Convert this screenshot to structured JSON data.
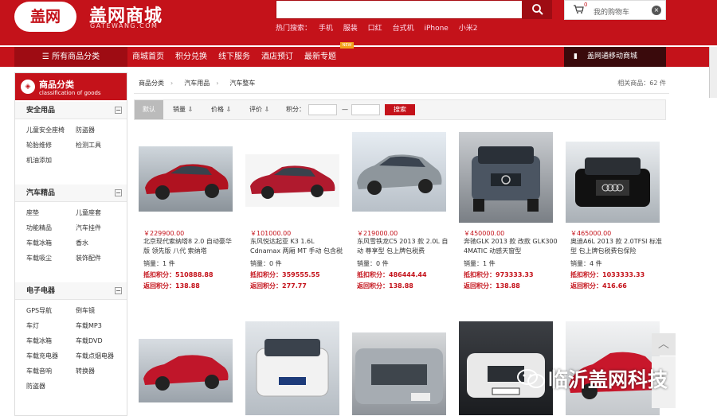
{
  "header": {
    "logo_badge": "盖网",
    "logo_name": "盖网商城",
    "logo_domain": "GATEWANG.COM",
    "hot_label": "热门搜索：",
    "hot_words": [
      "手机",
      "服装",
      "口红",
      "台式机",
      "iPhone",
      "小米2"
    ],
    "cart_text": "我的购物车",
    "cart_count": "0",
    "colors": {
      "brand": "#c4121a",
      "dark": "#9e0c13"
    }
  },
  "nav": {
    "all_label": "所有商品分类",
    "items": [
      "商城首页",
      "积分兑换",
      "线下服务",
      "酒店预订",
      "最新专题"
    ],
    "new_badge": "NEW",
    "phone_label": "盖网通移动商城"
  },
  "sidebar": {
    "title": "商品分类",
    "subtitle": "classification of goods",
    "sections": [
      {
        "title": "安全用品",
        "items": [
          "儿童安全座椅",
          "防盗器",
          "轮胎维修",
          "检测工具",
          "机油添加"
        ]
      },
      {
        "title": "汽车精品",
        "items": [
          "座垫",
          "儿童座套",
          "功能精品",
          "汽车挂件",
          "车载冰箱",
          "香水",
          "车载吸尘",
          "装饰配件"
        ]
      },
      {
        "title": "电子电器",
        "items": [
          "GPS导航",
          "倒车镜",
          "车灯",
          "车载MP3",
          "车载冰箱",
          "车载DVD",
          "车载充电器",
          "车载点烟电器",
          "车载音响",
          "转换器",
          "防盗器"
        ]
      }
    ]
  },
  "breadcrumb": {
    "items": [
      "商品分类",
      "汽车用品",
      "汽车整车"
    ],
    "count_text": "相关商品：62 件"
  },
  "filter": {
    "default_label": "默认",
    "sales_label": "销量 ⇩",
    "price_label": "价格 ⇩",
    "rating_label": "评价 ⇩",
    "points_label": "积分：",
    "dash": "—",
    "search_label": "搜索"
  },
  "products": [
    {
      "price": "￥229900.00",
      "name": "北京现代索纳塔8 2.0 自动豪华版 领先版 八代 索纳塔",
      "sales": "销量：1 件",
      "points": "抵扣积分：510888.88",
      "rebate": "返回积分：138.88"
    },
    {
      "price": "￥101000.00",
      "name": "东风悦达起亚 K3 1.6L Cdnamax 两厢 MT 手动 包含税费 上",
      "sales": "销量：0 件",
      "points": "抵扣积分：359555.55",
      "rebate": "返回积分：277.77"
    },
    {
      "price": "￥219000.00",
      "name": "东风雪铁龙C5 2013 款 2.0L 自动 尊享型 包上牌包税费",
      "sales": "销量：0 件",
      "points": "抵扣积分：486444.44",
      "rebate": "返回积分：138.88"
    },
    {
      "price": "￥450000.00",
      "name": "奔驰GLK 2013 款 改款 GLK300 4MATIC 动感天窗型",
      "sales": "销量：1 件",
      "points": "抵扣积分：973333.33",
      "rebate": "返回积分：138.88"
    },
    {
      "price": "￥465000.00",
      "name": "奥迪A6L 2013 款 2.0TFSI 标准型 包上牌包税费包保险",
      "sales": "销量：4 件",
      "points": "抵扣积分：1033333.33",
      "rebate": "返回积分：416.66"
    },
    {
      "price": "",
      "name": "",
      "sales": "",
      "points": "",
      "rebate": ""
    },
    {
      "price": "",
      "name": "",
      "sales": "",
      "points": "",
      "rebate": ""
    },
    {
      "price": "",
      "name": "",
      "sales": "",
      "points": "",
      "rebate": ""
    },
    {
      "price": "",
      "name": "",
      "sales": "",
      "points": "",
      "rebate": ""
    },
    {
      "price": "",
      "name": "",
      "sales": "",
      "points": "",
      "rebate": ""
    }
  ],
  "watermark": {
    "text": "临沂盖网科技"
  },
  "icons": {
    "search": "search-icon",
    "cart": "cart-icon",
    "menu": "menu-icon",
    "phone": "phone-icon",
    "arrow_up": "arrow-up-icon",
    "wechat": "wechat-icon"
  }
}
